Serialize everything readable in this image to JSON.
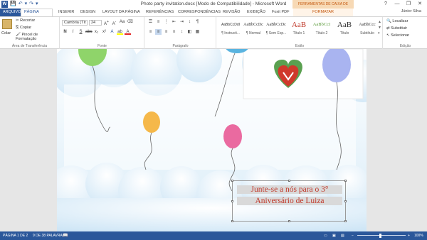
{
  "window": {
    "title": "Photo party invitation.docx [Modo de Compatibilidade] - Microsoft Word",
    "context_header": "FERRAMENTAS DE CAIXA DE TEXTO",
    "user": "Júnior Silva",
    "help": "?",
    "minimize": "—",
    "restore": "❐",
    "close": "✕"
  },
  "qat": {
    "save": "💾",
    "undo": "↶",
    "undo_drop": "▾",
    "redo": "↷",
    "customize": "▾"
  },
  "tabs": [
    "ARQUIVO",
    "PÁGINA INICIAL",
    "INSERIR",
    "DESIGN",
    "LAYOUT DA PÁGINA",
    "REFERÊNCIAS",
    "CORRESPONDÊNCIAS",
    "REVISÃO",
    "EXIBIÇÃO",
    "Foxit PDF",
    "FORMATAR"
  ],
  "ribbon": {
    "clipboard": {
      "paste": "Colar",
      "cut": "Recortar",
      "copy": "Copiar",
      "painter": "Pincel de Formatação",
      "label": "Área de Transferência"
    },
    "font": {
      "family": "Cambria (Tít",
      "size": "24",
      "label": "Fonte"
    },
    "paragraph": {
      "label": "Parágrafo"
    },
    "styles": {
      "label": "Estilo",
      "items": [
        {
          "sample": "AaBbCcDdI",
          "name": "¶ Instructi..."
        },
        {
          "sample": "AaBbCcDc",
          "name": "¶ Normal"
        },
        {
          "sample": "AaBbCcDc",
          "name": "¶ Sem Esp..."
        },
        {
          "sample": "AaB",
          "name": "Título 1"
        },
        {
          "sample": "AaBbCcI",
          "name": "Título 2"
        },
        {
          "sample": "AaB",
          "name": "Título"
        },
        {
          "sample": "AaBbCcc",
          "name": "Subtítulo"
        }
      ]
    },
    "editing": {
      "find": "Localizar",
      "replace": "Substituir",
      "select": "Selecionar",
      "label": "Edição"
    }
  },
  "document": {
    "line1": "Junte-se a nós para o 3°",
    "line2": "Aniversário de Luiza",
    "balloon_colors": [
      "#8fd46a",
      "#5ab4e0",
      "#a9b4f0",
      "#f5b84a",
      "#ea6aa0"
    ]
  },
  "status": {
    "page": "PÁGINA 1 DE 2",
    "words": "9 DE 38 PALAVRAS",
    "zoom": "100%"
  }
}
